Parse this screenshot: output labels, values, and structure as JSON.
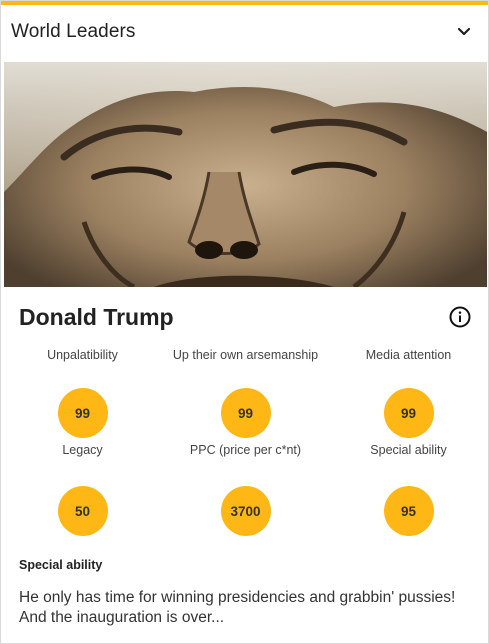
{
  "header": {
    "title": "World Leaders",
    "chevron_icon": "chevron-down-icon"
  },
  "card": {
    "name": "Donald Trump",
    "info_icon": "info-circle-icon",
    "accent_color": "#ffb716",
    "stats": [
      {
        "label": "Unpalatibility",
        "value": "99"
      },
      {
        "label": "Up their own arsemanship",
        "value": "99"
      },
      {
        "label": "Media attention",
        "value": "99"
      },
      {
        "label": "Legacy",
        "value": "50"
      },
      {
        "label": "PPC (price per c*nt)",
        "value": "3700"
      },
      {
        "label": "Special ability",
        "value": "95"
      }
    ],
    "special_ability": {
      "title": "Special ability",
      "text": "He only has time for winning presidencies and grabbin' pussies! And the inauguration is over..."
    }
  }
}
